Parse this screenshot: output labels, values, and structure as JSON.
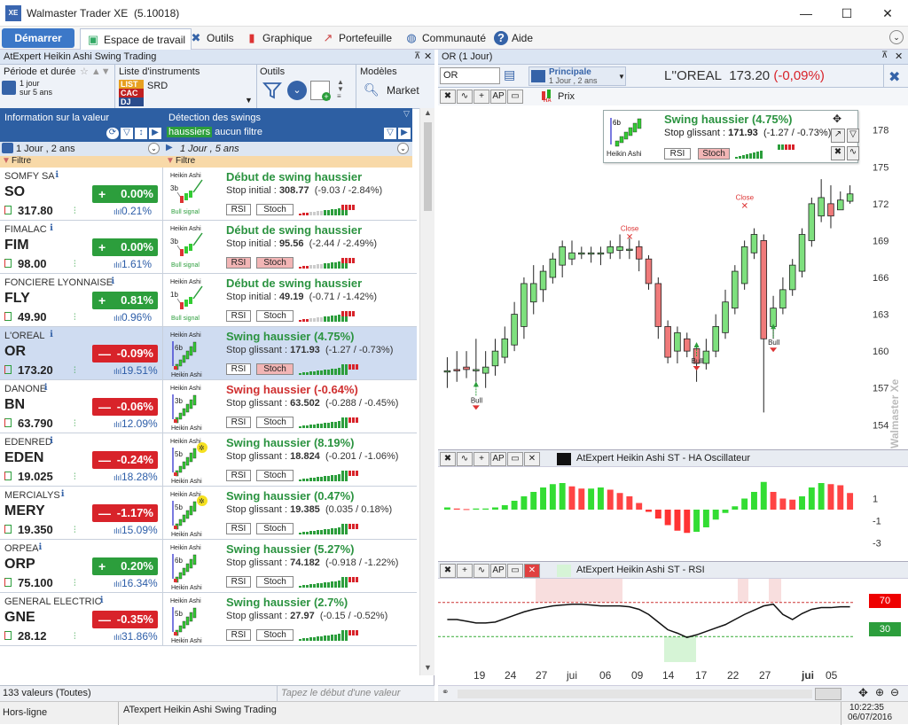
{
  "window": {
    "title": "Walmaster Trader XE",
    "version": "(5.10018)",
    "minimize": "—",
    "maximize": "☐",
    "close": "✕"
  },
  "toolbar": {
    "start": "Démarrer",
    "workspace": "Espace de travail",
    "tools": "Outils",
    "chart": "Graphique",
    "portfolio": "Portefeuille",
    "community": "Communauté",
    "help": "Aide"
  },
  "left": {
    "title": "AtExpert Heikin Ashi Swing Trading",
    "period_label": "Période et durée",
    "period_value_1": "1 jour",
    "period_value_2": "sur 5 ans",
    "list_label": "Liste d'instruments",
    "list_items": [
      "LIST",
      "CAC",
      "DJ"
    ],
    "list_value": "SRD",
    "tools_label": "Outils",
    "models_label": "Modèles",
    "models_value": "Market",
    "col1_title": "Information sur la valeur",
    "col2_title": "Détection des swings",
    "filter_tag": "haussiers",
    "filter_text": "aucun filtre",
    "col1_period": "1 Jour , 2 ans",
    "col2_period": "1 Jour , 5 ans",
    "filter1": "Filtre",
    "filter2": "Filtre",
    "heikin": "Heikin Ashi",
    "bull_signal": "Bull signal",
    "rsi": "RSI",
    "stoch": "Stoch",
    "rows": [
      {
        "name": "SOMFY SA",
        "ticker": "SO",
        "price": "317.80",
        "change": "0.00%",
        "sign": "+",
        "dir": "up",
        "vol": "0.21%",
        "swing": "Début de swing haussier",
        "swing_neg": false,
        "stop_label": "Stop initial :",
        "stop_val": "308.77",
        "stop_rest": "(-9.03 / -2.84%)",
        "count": "3b",
        "kind": "begin"
      },
      {
        "name": "FIMALAC",
        "ticker": "FIM",
        "price": "98.00",
        "change": "0.00%",
        "sign": "+",
        "dir": "up",
        "vol": "1.61%",
        "swing": "Début de swing haussier",
        "swing_neg": false,
        "stop_label": "Stop initial :",
        "stop_val": "95.56",
        "stop_rest": "(-2.44 / -2.49%)",
        "count": "3b",
        "kind": "begin"
      },
      {
        "name": "FONCIERE LYONNAISE",
        "ticker": "FLY",
        "price": "49.90",
        "change": "0.81%",
        "sign": "+",
        "dir": "up",
        "vol": "0.96%",
        "swing": "Début de swing haussier",
        "swing_neg": false,
        "stop_label": "Stop initial :",
        "stop_val": "49.19",
        "stop_rest": "(-0.71 / -1.42%)",
        "count": "1b",
        "kind": "begin"
      },
      {
        "name": "L'OREAL",
        "ticker": "OR",
        "price": "173.20",
        "change": "-0.09%",
        "sign": "—",
        "dir": "dn",
        "vol": "19.51%",
        "swing": "Swing haussier (4.75%)",
        "swing_neg": false,
        "stop_label": "Stop glissant :",
        "stop_val": "171.93",
        "stop_rest": "(-1.27 / -0.73%)",
        "count": "6b",
        "kind": "run"
      },
      {
        "name": "DANONE",
        "ticker": "BN",
        "price": "63.790",
        "change": "-0.06%",
        "sign": "—",
        "dir": "dn",
        "vol": "12.09%",
        "swing": "Swing haussier (-0.64%)",
        "swing_neg": true,
        "stop_label": "Stop glissant :",
        "stop_val": "63.502",
        "stop_rest": "(-0.288 / -0.45%)",
        "count": "3b",
        "kind": "run"
      },
      {
        "name": "EDENRED",
        "ticker": "EDEN",
        "price": "19.025",
        "change": "-0.24%",
        "sign": "—",
        "dir": "dn",
        "vol": "18.28%",
        "swing": "Swing haussier (8.19%)",
        "swing_neg": false,
        "stop_label": "Stop glissant :",
        "stop_val": "18.824",
        "stop_rest": "(-0.201 / -1.06%)",
        "count": "5b",
        "kind": "star"
      },
      {
        "name": "MERCIALYS",
        "ticker": "MERY",
        "price": "19.350",
        "change": "-1.17%",
        "sign": "—",
        "dir": "dn",
        "vol": "15.09%",
        "swing": "Swing haussier (0.47%)",
        "swing_neg": false,
        "stop_label": "Stop glissant :",
        "stop_val": "19.385",
        "stop_rest": "(0.035 / 0.18%)",
        "count": "5b",
        "kind": "star"
      },
      {
        "name": "ORPEA",
        "ticker": "ORP",
        "price": "75.100",
        "change": "0.20%",
        "sign": "+",
        "dir": "up",
        "vol": "16.34%",
        "swing": "Swing haussier (5.27%)",
        "swing_neg": false,
        "stop_label": "Stop glissant :",
        "stop_val": "74.182",
        "stop_rest": "(-0.918 / -1.22%)",
        "count": "6b",
        "kind": "run"
      },
      {
        "name": "GENERAL ELECTRIC",
        "ticker": "GNE",
        "price": "28.12",
        "change": "-0.35%",
        "sign": "—",
        "dir": "dn",
        "vol": "31.86%",
        "swing": "Swing haussier (2.7%)",
        "swing_neg": false,
        "stop_label": "Stop glissant :",
        "stop_val": "27.97",
        "stop_rest": "(-0.15 / -0.52%)",
        "count": "5b",
        "kind": "run"
      }
    ],
    "count_text": "133 valeurs (Toutes)",
    "search_placeholder": "Tapez le début d'une valeur"
  },
  "right": {
    "title": "OR (1 Jour)",
    "symbol": "OR",
    "layout_name": "Principale",
    "layout_sub": "1 Jour , 2 ans",
    "instrument": "L''OREAL",
    "price": "173.20",
    "change": "(-0,09%)",
    "price_label": "Prix",
    "swing_title": "Swing haussier (4.75%)",
    "swing_stop_label": "Stop glissant :",
    "swing_stop_val": "171.93",
    "swing_stop_rest": "(-1.27 / -0.73%)",
    "swing_count": "6b",
    "osc_title": "AtExpert Heikin Ashi ST - HA Oscillateur",
    "rsi_title": "AtExpert Heikin Ashi ST - RSI",
    "rsi_high": "70",
    "rsi_low": "30",
    "watermark": "Walmaster Xe",
    "close_label": "Close",
    "bull_label": "Bull",
    "y_ticks": [
      "178",
      "175",
      "172",
      "169",
      "166",
      "163",
      "160",
      "157",
      "154"
    ],
    "osc_ticks": [
      "1",
      "-1",
      "-3"
    ],
    "x_ticks": [
      "19",
      "24",
      "27",
      "jui",
      "06",
      "09",
      "14",
      "17",
      "22",
      "27",
      "juil",
      "05"
    ]
  },
  "status": {
    "left": "Hors-ligne",
    "center": "ATexpert Heikin Ashi Swing Trading",
    "time": "10:22:35",
    "date": "06/07/2016"
  },
  "colors": {
    "accent": "#2d5fa3",
    "up": "#2c9e3c",
    "down": "#d8232a",
    "candle_up": "#7ee07e",
    "candle_down": "#f07a7a"
  }
}
